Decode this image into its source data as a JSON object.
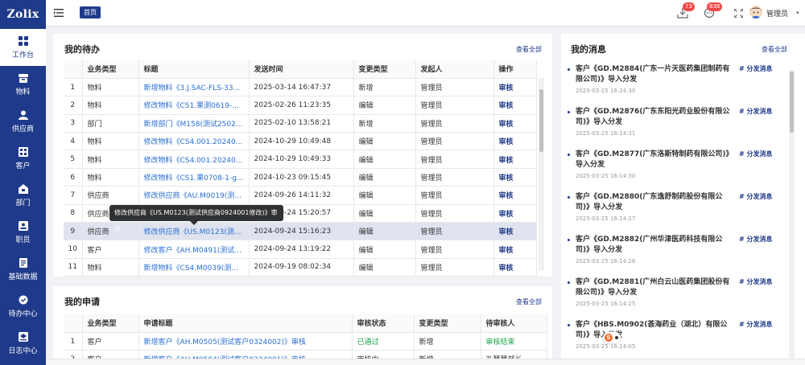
{
  "app": {
    "logo": "Zolix"
  },
  "sidebar": {
    "items": [
      {
        "label": "工作台",
        "icon": "dashboard-grid-icon",
        "active": true
      },
      {
        "label": "物料",
        "icon": "box-icon"
      },
      {
        "label": "供应商",
        "icon": "user-group-icon"
      },
      {
        "label": "客户",
        "icon": "building-icon"
      },
      {
        "label": "部门",
        "icon": "department-icon"
      },
      {
        "label": "职员",
        "icon": "id-card-icon"
      },
      {
        "label": "基础数据",
        "icon": "document-list-icon"
      },
      {
        "label": "待办中心",
        "icon": "todo-icon"
      },
      {
        "label": "日志中心",
        "icon": "log-icon"
      }
    ]
  },
  "topbar": {
    "home_tab": "首页",
    "download_badge": "73",
    "message_badge": "838",
    "username": "管理员",
    "caret": "▾"
  },
  "todo": {
    "title": "我的待办",
    "view_all": "查看全部",
    "columns": [
      "",
      "业务类型",
      "标题",
      "发送时间",
      "变更类型",
      "发起人",
      "操作"
    ],
    "rows": [
      {
        "n": "1",
        "type": "物料",
        "title": "新增物料《3.J.SAC-FLS-33...",
        "time": "2025-03-14 16:47:37",
        "change": "新增",
        "by": "管理员",
        "op": "审核"
      },
      {
        "n": "2",
        "type": "物料",
        "title": "修改物料《CS1.果测0619-...",
        "time": "2025-02-26 11:23:35",
        "change": "编辑",
        "by": "管理员",
        "op": "审核"
      },
      {
        "n": "3",
        "type": "部门",
        "title": "新增部门《M158(测试2502...",
        "time": "2025-02-10 13:58:21",
        "change": "新增",
        "by": "管理员",
        "op": "审核"
      },
      {
        "n": "4",
        "type": "物料",
        "title": "修改物料《CS4.001.20240...",
        "time": "2024-10-29 10:49:48",
        "change": "编辑",
        "by": "管理员",
        "op": "审核"
      },
      {
        "n": "5",
        "type": "物料",
        "title": "修改物料《CS4.001.20240...",
        "time": "2024-10-29 10:49:33",
        "change": "编辑",
        "by": "管理员",
        "op": "审核"
      },
      {
        "n": "6",
        "type": "物料",
        "title": "修改物料《CS1.果0708-1-g...",
        "time": "2024-10-23 09:15:45",
        "change": "编辑",
        "by": "管理员",
        "op": "审核"
      },
      {
        "n": "7",
        "type": "供应商",
        "title": "修改供应商《AU.M0019(测...",
        "time": "2024-09-26 14:11:32",
        "change": "编辑",
        "by": "管理员",
        "op": "审核"
      },
      {
        "n": "8",
        "type": "供应商",
        "title": "修改供应商《US.M0123(测...",
        "time": "2024-09-24 15:20:57",
        "change": "编辑",
        "by": "管理员",
        "op": "审核"
      },
      {
        "n": "9",
        "type": "供应商",
        "title": "修改供应商《US.M0123(测...",
        "time": "2024-09-24 15:16:23",
        "change": "编辑",
        "by": "管理员",
        "op": "审核"
      },
      {
        "n": "10",
        "type": "客户",
        "title": "修改客户《AH.M0491(测试...",
        "time": "2024-09-24 13:19:22",
        "change": "编辑",
        "by": "管理员",
        "op": "审核"
      },
      {
        "n": "11",
        "type": "物料",
        "title": "新增物料《CS4.M0039(测...",
        "time": "2024-09-19 08:02:34",
        "change": "编辑",
        "by": "管理员",
        "op": "审核"
      }
    ],
    "tooltip": "修改供应商《US.M0123(测试供应商0924001修改)》审核"
  },
  "apply": {
    "title": "我的申请",
    "view_all": "查看全部",
    "columns": [
      "",
      "业务类型",
      "申请标题",
      "审核状态",
      "变更类型",
      "待审核人"
    ],
    "rows": [
      {
        "n": "1",
        "type": "客户",
        "title": "新增客户《AH.M0505(测试客户0324002)》审核",
        "status": "已通过",
        "change": "新增",
        "by": "审核结束"
      },
      {
        "n": "2",
        "type": "客户",
        "title": "新增客户《AH.M0504(测试客户0324001)》审核",
        "status": "审核中",
        "change": "新增",
        "by": "孔慧慧部长"
      }
    ]
  },
  "messages": {
    "title": "我的消息",
    "view_all": "查看全部",
    "tag": "# 分发消息",
    "items": [
      {
        "text": "客户《GD.M2884(广东一片天医药集团制药有限公司)》导入分发",
        "time": "2025-03-25 16:24:30"
      },
      {
        "text": "客户《GD.M2876(广东东阳光药业股份有限公司)》导入分发",
        "time": "2025-03-25 16:14:31"
      },
      {
        "text": "客户《GD.M2877(广东洛斯特制药有限公司)》导入分发",
        "time": "2025-03-25 16:14:30"
      },
      {
        "text": "客户《GD.M2880(广东逸舒制药股份有限公司)》导入分发",
        "time": "2025-03-25 16:14:27"
      },
      {
        "text": "客户《GD.M2882(广州华津医药科技有限公司)》导入分发",
        "time": "2025-03-25 16:14:26"
      },
      {
        "text": "客户《GD.M2881(广州白云山医药集团股份有限公司)》导入分发",
        "time": "2025-03-25 16:14:25"
      },
      {
        "text": "客户《HBS.M0902(荟海药业（湖北）有限公司)》导入分发",
        "time": "2025-03-25 16:14:05"
      }
    ]
  },
  "chat_widget": {
    "label": "S"
  }
}
